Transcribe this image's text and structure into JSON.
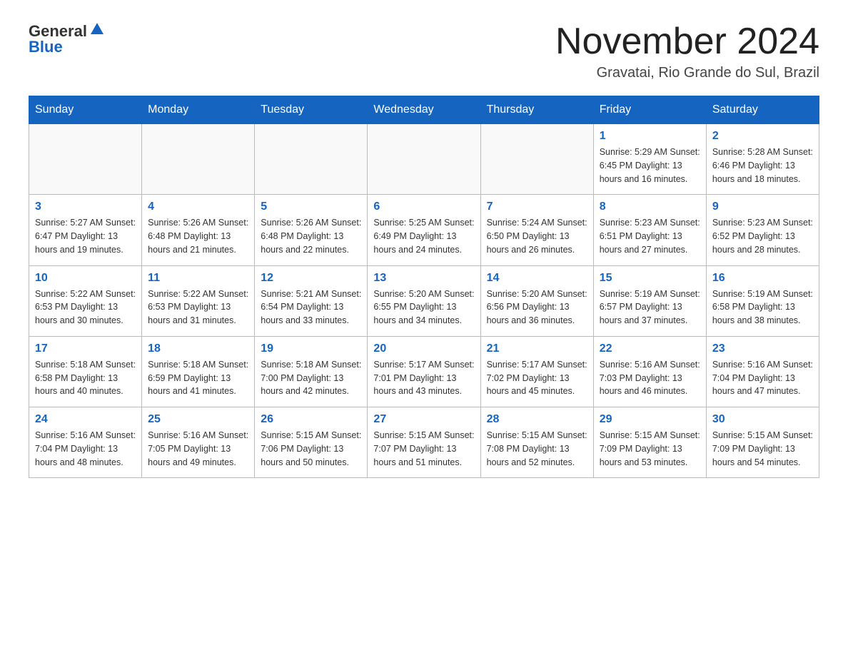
{
  "header": {
    "logo": {
      "general": "General",
      "blue": "Blue"
    },
    "title": "November 2024",
    "location": "Gravatai, Rio Grande do Sul, Brazil"
  },
  "calendar": {
    "days_of_week": [
      "Sunday",
      "Monday",
      "Tuesday",
      "Wednesday",
      "Thursday",
      "Friday",
      "Saturday"
    ],
    "weeks": [
      [
        {
          "day": "",
          "info": ""
        },
        {
          "day": "",
          "info": ""
        },
        {
          "day": "",
          "info": ""
        },
        {
          "day": "",
          "info": ""
        },
        {
          "day": "",
          "info": ""
        },
        {
          "day": "1",
          "info": "Sunrise: 5:29 AM\nSunset: 6:45 PM\nDaylight: 13 hours and 16 minutes."
        },
        {
          "day": "2",
          "info": "Sunrise: 5:28 AM\nSunset: 6:46 PM\nDaylight: 13 hours and 18 minutes."
        }
      ],
      [
        {
          "day": "3",
          "info": "Sunrise: 5:27 AM\nSunset: 6:47 PM\nDaylight: 13 hours and 19 minutes."
        },
        {
          "day": "4",
          "info": "Sunrise: 5:26 AM\nSunset: 6:48 PM\nDaylight: 13 hours and 21 minutes."
        },
        {
          "day": "5",
          "info": "Sunrise: 5:26 AM\nSunset: 6:48 PM\nDaylight: 13 hours and 22 minutes."
        },
        {
          "day": "6",
          "info": "Sunrise: 5:25 AM\nSunset: 6:49 PM\nDaylight: 13 hours and 24 minutes."
        },
        {
          "day": "7",
          "info": "Sunrise: 5:24 AM\nSunset: 6:50 PM\nDaylight: 13 hours and 26 minutes."
        },
        {
          "day": "8",
          "info": "Sunrise: 5:23 AM\nSunset: 6:51 PM\nDaylight: 13 hours and 27 minutes."
        },
        {
          "day": "9",
          "info": "Sunrise: 5:23 AM\nSunset: 6:52 PM\nDaylight: 13 hours and 28 minutes."
        }
      ],
      [
        {
          "day": "10",
          "info": "Sunrise: 5:22 AM\nSunset: 6:53 PM\nDaylight: 13 hours and 30 minutes."
        },
        {
          "day": "11",
          "info": "Sunrise: 5:22 AM\nSunset: 6:53 PM\nDaylight: 13 hours and 31 minutes."
        },
        {
          "day": "12",
          "info": "Sunrise: 5:21 AM\nSunset: 6:54 PM\nDaylight: 13 hours and 33 minutes."
        },
        {
          "day": "13",
          "info": "Sunrise: 5:20 AM\nSunset: 6:55 PM\nDaylight: 13 hours and 34 minutes."
        },
        {
          "day": "14",
          "info": "Sunrise: 5:20 AM\nSunset: 6:56 PM\nDaylight: 13 hours and 36 minutes."
        },
        {
          "day": "15",
          "info": "Sunrise: 5:19 AM\nSunset: 6:57 PM\nDaylight: 13 hours and 37 minutes."
        },
        {
          "day": "16",
          "info": "Sunrise: 5:19 AM\nSunset: 6:58 PM\nDaylight: 13 hours and 38 minutes."
        }
      ],
      [
        {
          "day": "17",
          "info": "Sunrise: 5:18 AM\nSunset: 6:58 PM\nDaylight: 13 hours and 40 minutes."
        },
        {
          "day": "18",
          "info": "Sunrise: 5:18 AM\nSunset: 6:59 PM\nDaylight: 13 hours and 41 minutes."
        },
        {
          "day": "19",
          "info": "Sunrise: 5:18 AM\nSunset: 7:00 PM\nDaylight: 13 hours and 42 minutes."
        },
        {
          "day": "20",
          "info": "Sunrise: 5:17 AM\nSunset: 7:01 PM\nDaylight: 13 hours and 43 minutes."
        },
        {
          "day": "21",
          "info": "Sunrise: 5:17 AM\nSunset: 7:02 PM\nDaylight: 13 hours and 45 minutes."
        },
        {
          "day": "22",
          "info": "Sunrise: 5:16 AM\nSunset: 7:03 PM\nDaylight: 13 hours and 46 minutes."
        },
        {
          "day": "23",
          "info": "Sunrise: 5:16 AM\nSunset: 7:04 PM\nDaylight: 13 hours and 47 minutes."
        }
      ],
      [
        {
          "day": "24",
          "info": "Sunrise: 5:16 AM\nSunset: 7:04 PM\nDaylight: 13 hours and 48 minutes."
        },
        {
          "day": "25",
          "info": "Sunrise: 5:16 AM\nSunset: 7:05 PM\nDaylight: 13 hours and 49 minutes."
        },
        {
          "day": "26",
          "info": "Sunrise: 5:15 AM\nSunset: 7:06 PM\nDaylight: 13 hours and 50 minutes."
        },
        {
          "day": "27",
          "info": "Sunrise: 5:15 AM\nSunset: 7:07 PM\nDaylight: 13 hours and 51 minutes."
        },
        {
          "day": "28",
          "info": "Sunrise: 5:15 AM\nSunset: 7:08 PM\nDaylight: 13 hours and 52 minutes."
        },
        {
          "day": "29",
          "info": "Sunrise: 5:15 AM\nSunset: 7:09 PM\nDaylight: 13 hours and 53 minutes."
        },
        {
          "day": "30",
          "info": "Sunrise: 5:15 AM\nSunset: 7:09 PM\nDaylight: 13 hours and 54 minutes."
        }
      ]
    ]
  }
}
